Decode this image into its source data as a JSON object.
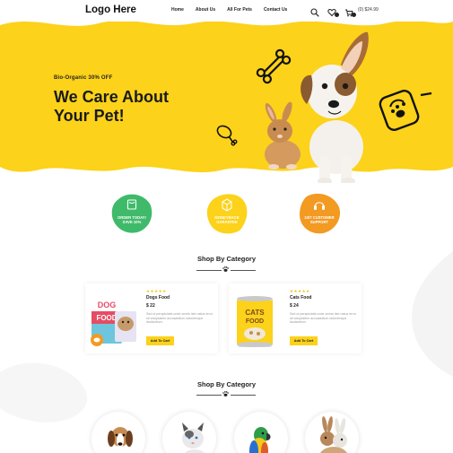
{
  "header": {
    "logo": "Logo Here",
    "nav": [
      "Home",
      "About Us",
      "All For Pets",
      "Contact Us"
    ],
    "cart_price": "(0) $24.99",
    "icons": [
      "search-icon",
      "heart-icon",
      "cart-icon"
    ]
  },
  "hero": {
    "subtitle": "Bio-Organic 30% OFF",
    "title": "We Care About Your Pet!"
  },
  "features": [
    {
      "label_line1": "ORDER TODAY!",
      "label_line2": "SAVE 10%",
      "color": "#3fba6a",
      "icon": "bag-icon"
    },
    {
      "label_line1": "MONEYBACK",
      "label_line2": "GARANTEE",
      "color": "#fcd21a",
      "icon": "box-icon"
    },
    {
      "label_line1": "24/7 CUSTOMER",
      "label_line2": "SUPPORT",
      "color": "#f39a22",
      "icon": "headset-icon"
    }
  ],
  "shop_section_1": {
    "title": "Shop By Category"
  },
  "shop_section_2": {
    "title": "Shop By Category"
  },
  "products": [
    {
      "name": "Dogs Food",
      "price": "$ 22",
      "rating": 5,
      "description": "Sed ut perspiciatis unde omnis iste natus error sit voluptatem accusantium doloremque laudantium.",
      "button": "Add To Cart",
      "image_label_top": "DOG",
      "image_label_bottom": "FOOD"
    },
    {
      "name": "Cats Food",
      "price": "$ 24",
      "rating": 5,
      "description": "Sed ut perspiciatis unde omnis iste natus error sit voluptatem accusantium doloremque laudantium.",
      "button": "Add To Cart",
      "image_label_top": "CATS",
      "image_label_bottom": "FOOD"
    }
  ],
  "colors": {
    "accent": "#fcd21a",
    "green": "#3fba6a",
    "orange": "#f39a22",
    "text": "#1a1a1a"
  }
}
